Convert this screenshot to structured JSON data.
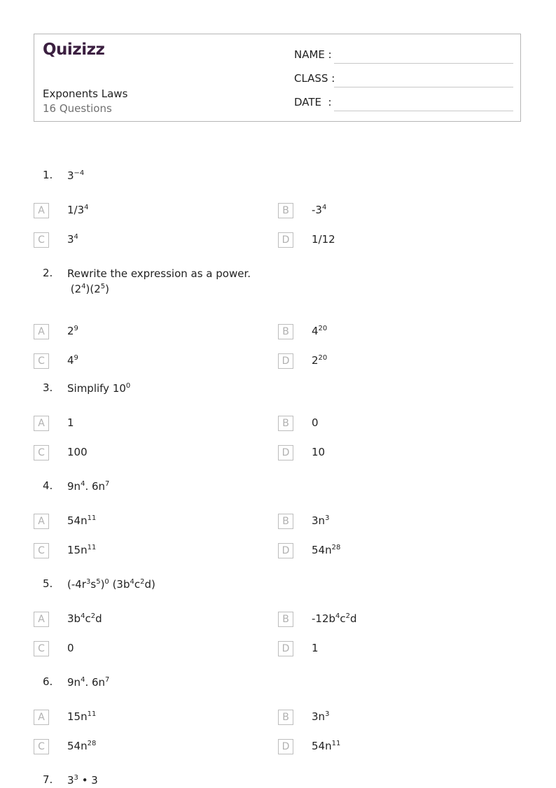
{
  "header": {
    "logo": "Quizizz",
    "title": "Exponents Laws",
    "subtitle": "16 Questions",
    "fields": [
      {
        "label": "NAME :"
      },
      {
        "label": "CLASS :"
      },
      {
        "label": "DATE  :"
      }
    ]
  },
  "questions": [
    {
      "number": "1.",
      "text_html": "3<sup>−4</sup>",
      "options": [
        {
          "letter": "A",
          "html": "1/3<sup>4</sup>"
        },
        {
          "letter": "B",
          "html": "-3<sup>4</sup>"
        },
        {
          "letter": "C",
          "html": "3<sup>4</sup>"
        },
        {
          "letter": "D",
          "html": "1/12"
        }
      ]
    },
    {
      "number": "2.",
      "text_html": "Rewrite the expression as a power.<br>&nbsp;(2<sup>4</sup>)(2<sup>5</sup>)",
      "options": [
        {
          "letter": "A",
          "html": "2<sup>9</sup>"
        },
        {
          "letter": "B",
          "html": "4<sup>20</sup>"
        },
        {
          "letter": "C",
          "html": "4<sup>9</sup>"
        },
        {
          "letter": "D",
          "html": "2<sup>20</sup>"
        }
      ]
    },
    {
      "number": "3.",
      "text_html": "Simplify 10<sup>0</sup>",
      "options": [
        {
          "letter": "A",
          "html": "1"
        },
        {
          "letter": "B",
          "html": "0"
        },
        {
          "letter": "C",
          "html": "100"
        },
        {
          "letter": "D",
          "html": "10"
        }
      ]
    },
    {
      "number": "4.",
      "text_html": "9n<sup>4</sup>. 6n<sup>7</sup>",
      "options": [
        {
          "letter": "A",
          "html": "54n<sup>11</sup>"
        },
        {
          "letter": "B",
          "html": "3n<sup>3</sup>"
        },
        {
          "letter": "C",
          "html": "15n<sup>11</sup>"
        },
        {
          "letter": "D",
          "html": "54n<sup>28</sup>"
        }
      ]
    },
    {
      "number": "5.",
      "text_html": "(-4r<sup>3</sup>s<sup>5</sup>)<sup>0</sup> (3b<sup>4</sup>c<sup>2</sup>d)",
      "options": [
        {
          "letter": "A",
          "html": "3b<sup>4</sup>c<sup>2</sup>d"
        },
        {
          "letter": "B",
          "html": "-12b<sup>4</sup>c<sup>2</sup>d"
        },
        {
          "letter": "C",
          "html": "0"
        },
        {
          "letter": "D",
          "html": "1"
        }
      ]
    },
    {
      "number": "6.",
      "text_html": "9n<sup>4</sup>. 6n<sup>7</sup>",
      "options": [
        {
          "letter": "A",
          "html": "15n<sup>11</sup>"
        },
        {
          "letter": "B",
          "html": "3n<sup>3</sup>"
        },
        {
          "letter": "C",
          "html": "54n<sup>28</sup>"
        },
        {
          "letter": "D",
          "html": "54n<sup>11</sup>"
        }
      ]
    },
    {
      "number": "7.",
      "text_html": "3<sup>3</sup> • 3",
      "options": []
    }
  ]
}
